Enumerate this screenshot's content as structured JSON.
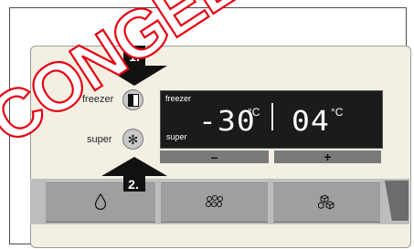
{
  "panel": {
    "freezer_label": "freezer",
    "super_label": "super",
    "step1_label": "1.",
    "step2_label": "2."
  },
  "display": {
    "freezer_label": "freezer",
    "super_label": "super",
    "freezer_temp": "-30",
    "freezer_unit": "°C",
    "fridge_temp": "04",
    "fridge_unit": "°C"
  },
  "controls": {
    "minus_label": "–",
    "plus_label": "+"
  },
  "watermark": {
    "text": "CONGELAT"
  },
  "colors": {
    "watermark_red": "#e60012",
    "display_bg": "#1b1b1b"
  }
}
